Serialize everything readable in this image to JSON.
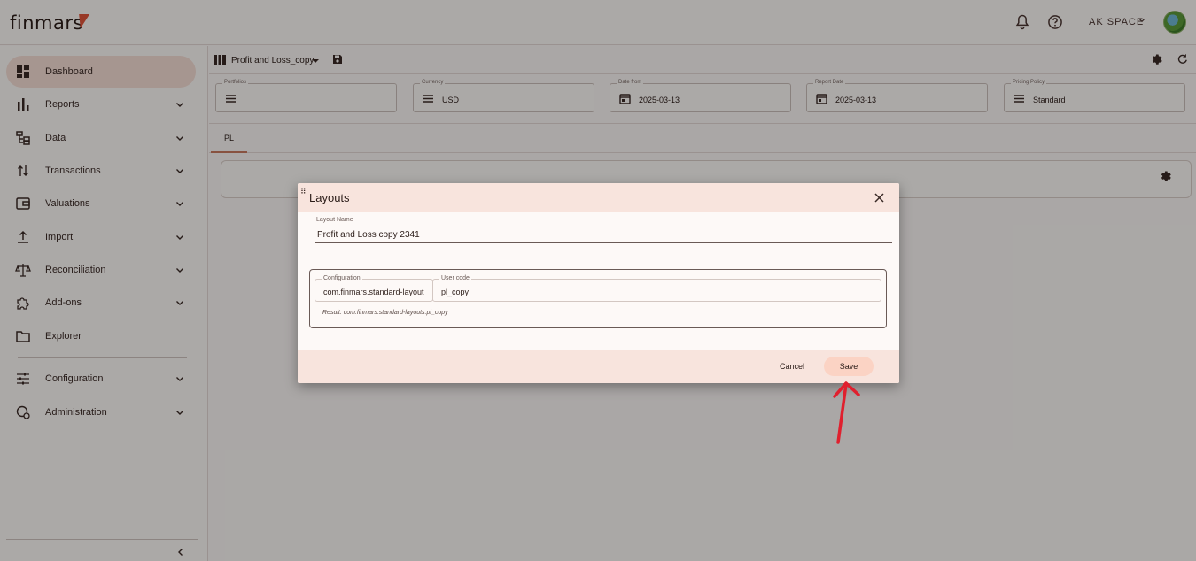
{
  "app": {
    "logo": "finmars"
  },
  "topbar": {
    "space": "AK SPACE",
    "icons": [
      "bell-icon",
      "help-icon",
      "chevron-down-icon"
    ]
  },
  "sidebar": {
    "items": [
      {
        "label": "Dashboard",
        "icon": "dashboard-icon",
        "active": true
      },
      {
        "label": "Reports",
        "icon": "bar-chart-icon"
      },
      {
        "label": "Data",
        "icon": "tree-icon"
      },
      {
        "label": "Transactions",
        "icon": "swap-icon"
      },
      {
        "label": "Valuations",
        "icon": "wallet-icon"
      },
      {
        "label": "Import",
        "icon": "upload-icon"
      },
      {
        "label": "Reconciliation",
        "icon": "scale-icon"
      },
      {
        "label": "Add-ons",
        "icon": "puzzle-icon"
      },
      {
        "label": "Explorer",
        "icon": "folder-icon"
      },
      {
        "label": "Configuration",
        "icon": "sliders-icon"
      },
      {
        "label": "Administration",
        "icon": "admin-icon"
      }
    ]
  },
  "header": {
    "layout_name": "Profit and Loss_copy"
  },
  "filters": [
    {
      "label": "Portfolios",
      "value": "",
      "icon": "list-icon"
    },
    {
      "label": "Currency",
      "value": "USD",
      "icon": "list-icon"
    },
    {
      "label": "Date from",
      "value": "2025-03-13",
      "icon": "calendar-icon"
    },
    {
      "label": "Report Date",
      "value": "2025-03-13",
      "icon": "calendar-icon"
    },
    {
      "label": "Pricing Policy",
      "value": "Standard",
      "icon": "list-icon"
    }
  ],
  "tabs": [
    {
      "label": "PL"
    }
  ],
  "dialog": {
    "title": "Layouts",
    "layout_name_label": "Layout Name",
    "layout_name_value": "Profit and Loss copy 2341",
    "configuration_label": "Configuration",
    "configuration_value": "com.finmars.standard-layout",
    "user_code_label": "User code",
    "user_code_value": "pl_copy",
    "result": "Result: com.finmars.standard-layouts:pl_copy",
    "cancel_label": "Cancel",
    "save_label": "Save"
  },
  "colors": {
    "accent": "#f8e4dd",
    "save_button": "#fbd3c4",
    "annotation_arrow": "#e0202e"
  }
}
